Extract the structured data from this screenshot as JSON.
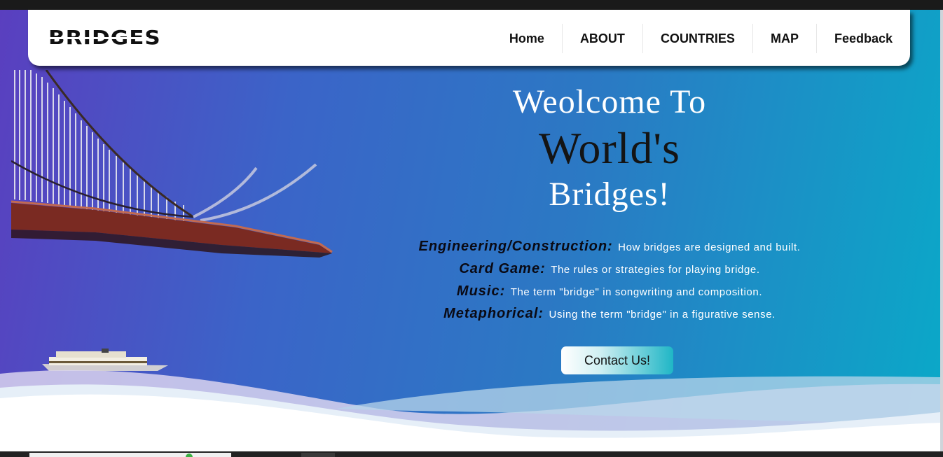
{
  "brand": {
    "logo_text": "BRIDGES"
  },
  "nav": {
    "items": [
      {
        "label": "Home"
      },
      {
        "label": "ABOUT"
      },
      {
        "label": "COUNTRIES"
      },
      {
        "label": "MAP"
      },
      {
        "label": "Feedback"
      }
    ]
  },
  "hero": {
    "line1": "Weolcome To",
    "line2": "World's",
    "line3": "Bridges!",
    "topics": [
      {
        "term": "Engineering/Construction:",
        "desc": "How bridges are designed and built."
      },
      {
        "term": "Card Game:",
        "desc": "The rules or strategies for playing bridge."
      },
      {
        "term": "Music:",
        "desc": "The term \"bridge\" in songwriting and composition."
      },
      {
        "term": "Metaphorical:",
        "desc": "Using the term \"bridge\" in a figurative sense."
      }
    ],
    "cta_label": "Contact Us!"
  },
  "colors": {
    "gradient_start": "#5a3fbf",
    "gradient_end": "#0aa9c8",
    "nav_bg": "#ffffff",
    "heading_white": "#ffffff",
    "heading_dark": "#141414"
  },
  "icons": {
    "bridge_image": "suspension-bridge-image",
    "ship_image": "ferry-ship-image",
    "waves": "wave-decoration"
  }
}
